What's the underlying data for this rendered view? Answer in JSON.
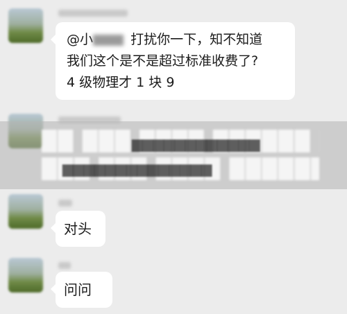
{
  "messages": [
    {
      "mention_prefix": "@小",
      "text_line1": "打扰你一下，知不知道",
      "text_line2": "我们这个是不是超过标准收费了?",
      "text_line3": "4 级物理才 1 块 9"
    },
    {
      "text": "对头"
    },
    {
      "text": "问问"
    }
  ]
}
